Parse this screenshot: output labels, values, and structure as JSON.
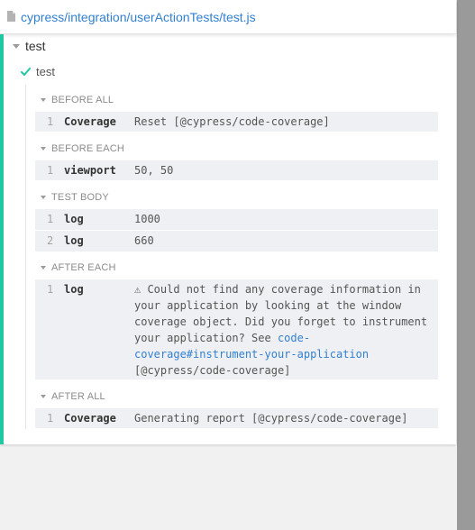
{
  "file": {
    "path": "cypress/integration/userActionTests/test.js"
  },
  "suite": {
    "title": "test"
  },
  "test": {
    "title": "test"
  },
  "hooks": {
    "before_all": {
      "label": "BEFORE ALL",
      "commands": [
        {
          "num": "1",
          "name": "Coverage",
          "message": "Reset [@cypress/code-coverage]"
        }
      ]
    },
    "before_each": {
      "label": "BEFORE EACH",
      "commands": [
        {
          "num": "1",
          "name": "viewport",
          "message": "50, 50"
        }
      ]
    },
    "test_body": {
      "label": "TEST BODY",
      "commands": [
        {
          "num": "1",
          "name": "log",
          "message": "1000"
        },
        {
          "num": "2",
          "name": "log",
          "message": "660"
        }
      ]
    },
    "after_each": {
      "label": "AFTER EACH",
      "commands": [
        {
          "num": "1",
          "name": "log",
          "message_lines": [
            "⚠ Could not find any coverage information in",
            "your application by looking at the window",
            "coverage object. Did you forget to instrument",
            "your application? See "
          ],
          "link_part1": "code-",
          "link_part2": "coverage#instrument-your-application",
          "message_tail": "[@cypress/code-coverage]"
        }
      ]
    },
    "after_all": {
      "label": "AFTER ALL",
      "commands": [
        {
          "num": "1",
          "name": "Coverage",
          "message": "Generating report [@cypress/code-coverage]"
        }
      ]
    }
  },
  "colors": {
    "passed": "#1fc8a3",
    "link": "#3380d0",
    "command_bg": "#eef0f3"
  }
}
